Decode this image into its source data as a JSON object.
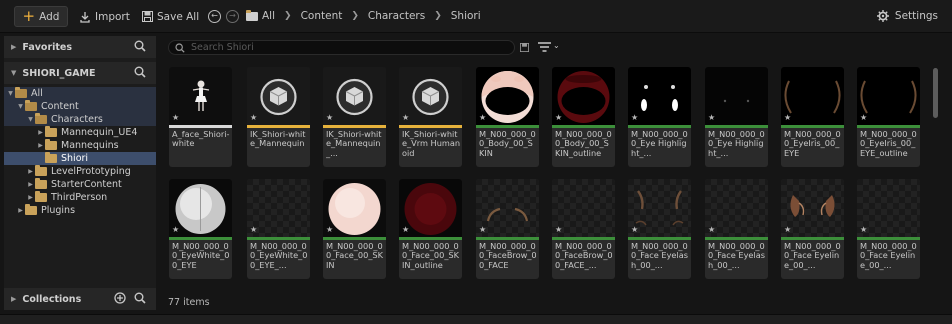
{
  "toolbar": {
    "add_label": "Add",
    "import_label": "Import",
    "saveall_label": "Save All",
    "settings_label": "Settings"
  },
  "breadcrumbs": [
    "All",
    "Content",
    "Characters",
    "Shiori"
  ],
  "left": {
    "favorites_label": "Favorites",
    "project_label": "SHIORI_GAME",
    "collections_label": "Collections",
    "tree": [
      {
        "label": "All",
        "depth": 0,
        "state": "open"
      },
      {
        "label": "Content",
        "depth": 1,
        "state": "open"
      },
      {
        "label": "Characters",
        "depth": 2,
        "state": "open"
      },
      {
        "label": "Mannequin_UE4",
        "depth": 3,
        "state": "closed"
      },
      {
        "label": "Mannequins",
        "depth": 3,
        "state": "closed"
      },
      {
        "label": "Shiori",
        "depth": 3,
        "state": "selected"
      },
      {
        "label": "LevelPrototyping",
        "depth": 2,
        "state": "closed"
      },
      {
        "label": "StarterContent",
        "depth": 2,
        "state": "closed"
      },
      {
        "label": "ThirdPerson",
        "depth": 2,
        "state": "closed"
      },
      {
        "label": "Plugins",
        "depth": 1,
        "state": "closed"
      }
    ]
  },
  "search": {
    "placeholder": "Search Shiori"
  },
  "assets": [
    {
      "name": "A_face_Shiori-white",
      "thumb": "figure",
      "strip": "#d8d8d8"
    },
    {
      "name": "IK_Shiori-white_Mannequin",
      "thumb": "cube",
      "strip": "#e6b23c"
    },
    {
      "name": "IK_Shiori-white_Mannequin_...",
      "thumb": "cube",
      "strip": "#e6b23c"
    },
    {
      "name": "IK_Shiori-white_Vrm Humanoid",
      "thumb": "cube",
      "strip": "#e6b23c"
    },
    {
      "name": "M_N00_000_00_Body_00_SKIN",
      "thumb": "body-skin",
      "strip": "#3c8f3a"
    },
    {
      "name": "M_N00_000_00_Body_00_SKIN_outline",
      "thumb": "body-outline",
      "strip": "#3c8f3a"
    },
    {
      "name": "M_N00_000_00_Eye Highlight_...",
      "thumb": "eye-highlight",
      "strip": "#3c8f3a"
    },
    {
      "name": "M_N00_000_00_Eye Highlight_...",
      "thumb": "dots",
      "strip": "#3c8f3a"
    },
    {
      "name": "M_N00_000_00_EyeIris_00_EYE",
      "thumb": "iris",
      "strip": "#3c8f3a"
    },
    {
      "name": "M_N00_000_00_EyeIris_00_EYE_outline",
      "thumb": "iris",
      "strip": "#3c8f3a"
    },
    {
      "name": "M_N00_000_00_EyeWhite_00_EYE",
      "thumb": "eyewhite",
      "strip": "#3c8f3a"
    },
    {
      "name": "M_N00_000_00_EyeWhite_00_EYE_...",
      "thumb": "empty",
      "strip": "#3c8f3a"
    },
    {
      "name": "M_N00_000_00_Face_00_SKIN",
      "thumb": "face-skin",
      "strip": "#3c8f3a"
    },
    {
      "name": "M_N00_000_00_Face_00_SKIN_outline",
      "thumb": "face-outline",
      "strip": "#3c8f3a"
    },
    {
      "name": "M_N00_000_00_FaceBrow_00_FACE",
      "thumb": "brow",
      "strip": "#3c8f3a"
    },
    {
      "name": "M_N00_000_00_FaceBrow_00_FACE_...",
      "thumb": "empty",
      "strip": "#3c8f3a"
    },
    {
      "name": "M_N00_000_00_Face Eyelash_00_...",
      "thumb": "lash",
      "strip": "#3c8f3a"
    },
    {
      "name": "M_N00_000_00_Face Eyelash_00_...",
      "thumb": "empty",
      "strip": "#3c8f3a"
    },
    {
      "name": "M_N00_000_00_Face Eyeline_00_...",
      "thumb": "eyeline",
      "strip": "#3c8f3a"
    },
    {
      "name": "M_N00_000_00_Face Eyeline_00_...",
      "thumb": "empty",
      "strip": "#3c8f3a"
    }
  ],
  "status": {
    "count": "77 items"
  },
  "colors": {
    "accent": "#f0b23e",
    "selected": "#3d4e6c",
    "material_strip": "#3c8f3a",
    "ik_strip": "#e6b23c"
  }
}
